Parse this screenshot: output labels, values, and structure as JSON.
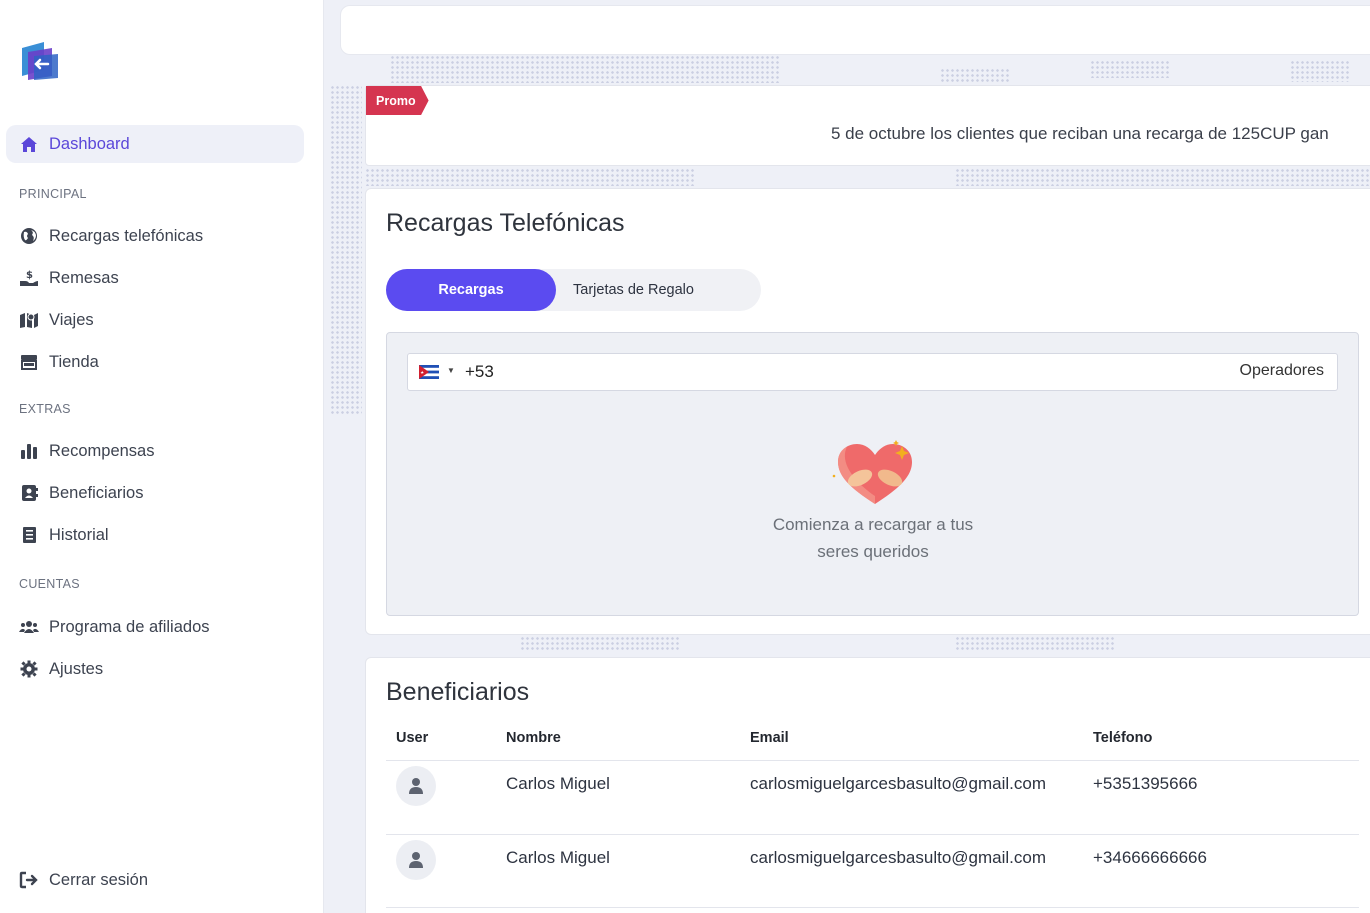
{
  "sidebar": {
    "dashboard": "Dashboard",
    "sections": {
      "principal": "PRINCIPAL",
      "extras": "EXTRAS",
      "cuentas": "CUENTAS"
    },
    "items": {
      "recargas": "Recargas telefónicas",
      "remesas": "Remesas",
      "viajes": "Viajes",
      "tienda": "Tienda",
      "recompensas": "Recompensas",
      "beneficiarios": "Beneficiarios",
      "historial": "Historial",
      "afiliados": "Programa de afiliados",
      "ajustes": "Ajustes"
    },
    "logout": "Cerrar sesión"
  },
  "promo": {
    "tag": "Promo",
    "text": "5 de octubre los clientes que reciban una recarga de 125CUP gan"
  },
  "recargas": {
    "title": "Recargas Telefónicas",
    "tabs": {
      "active": "Recargas",
      "inactive": "Tarjetas de Regalo"
    },
    "phone": {
      "value": "+53",
      "operadores": "Operadores"
    },
    "empty_line1": "Comienza a recargar a tus",
    "empty_line2": "seres queridos"
  },
  "beneficiarios": {
    "title": "Beneficiarios",
    "columns": {
      "user": "User",
      "nombre": "Nombre",
      "email": "Email",
      "telefono": "Teléfono"
    },
    "rows": [
      {
        "nombre": "Carlos Miguel",
        "email": "carlosmiguelgarcesbasulto@gmail.com",
        "telefono": "+5351395666"
      },
      {
        "nombre": "Carlos Miguel",
        "email": "carlosmiguelgarcesbasulto@gmail.com",
        "telefono": "+34666666666"
      }
    ]
  },
  "colors": {
    "accent": "#5b4bf0",
    "promo_tag": "#d53550",
    "active_nav": "#5b47d9"
  }
}
